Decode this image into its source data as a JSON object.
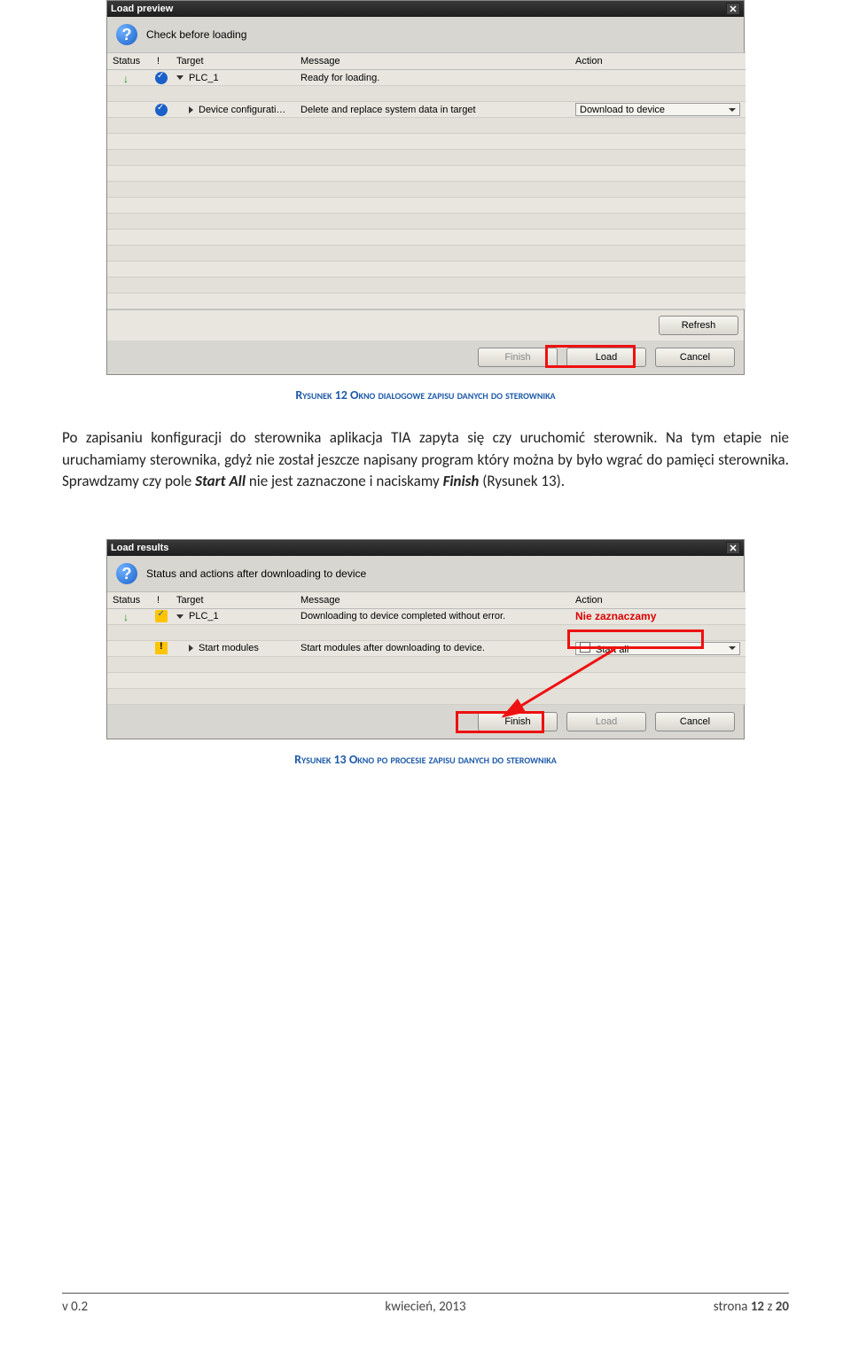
{
  "dialog1": {
    "title": "Load preview",
    "info": "Check before loading",
    "headers": {
      "status": "Status",
      "bang": "!",
      "target": "Target",
      "message": "Message",
      "action": "Action"
    },
    "rows": [
      {
        "target": "PLC_1",
        "message": "Ready for loading.",
        "action": ""
      },
      {
        "target": "Device configurati…",
        "message": "Delete and replace system data in target",
        "action": "Download to device"
      }
    ],
    "refresh": "Refresh",
    "btn_finish": "Finish",
    "btn_load": "Load",
    "btn_cancel": "Cancel"
  },
  "caption1": "Rysunek 12 Okno dialogowe zapisu danych do sterownika",
  "para1_a": "Po zapisaniu konfiguracji do sterownika aplikacja TIA zapyta się czy uruchomić sterownik. Na tym etapie nie uruchamiamy sterownika, gdyż nie został jeszcze napisany program który można by było wgrać do pamięci sterownika. Sprawdzamy czy pole ",
  "para1_b": "Start All",
  "para1_c": " nie jest zaznaczone i naciskamy ",
  "para1_d": "Finish",
  "para1_e": " (Rysunek 13).",
  "dialog2": {
    "title": "Load results",
    "info": "Status and actions after downloading to device",
    "headers": {
      "status": "Status",
      "bang": "!",
      "target": "Target",
      "message": "Message",
      "action": "Action"
    },
    "rows": [
      {
        "target": "PLC_1",
        "message": "Downloading to device completed without error.",
        "action": ""
      },
      {
        "target": "Start modules",
        "message": "Start modules after downloading to device.",
        "action": "Start all"
      }
    ],
    "nz": "Nie zaznaczamy",
    "btn_finish": "Finish",
    "btn_load": "Load",
    "btn_cancel": "Cancel"
  },
  "caption2": "Rysunek 13 Okno po procesie zapisu danych do sterownika",
  "footer": {
    "left": "v 0.2",
    "center": "kwiecień, 2013",
    "right_a": "strona ",
    "right_b": "12",
    "right_c": " z ",
    "right_d": "20"
  }
}
